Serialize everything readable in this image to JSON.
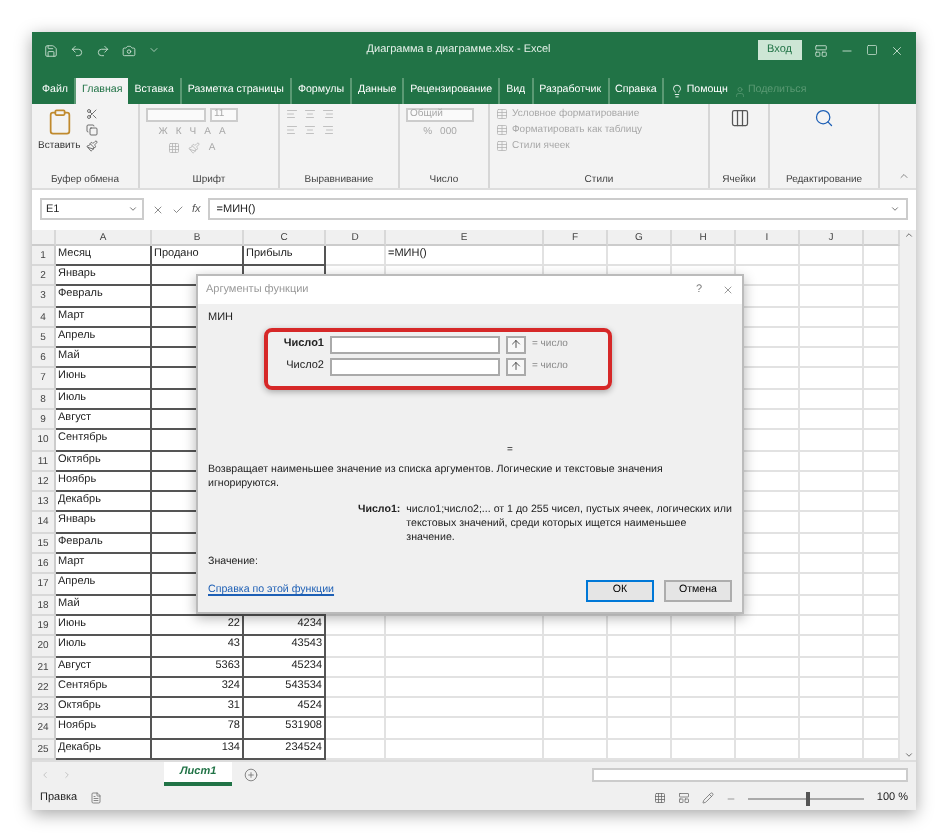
{
  "window": {
    "title": "Диаграмма в диаграмме.xlsx - Excel",
    "sign_in": "Вход"
  },
  "tabs": [
    {
      "label": "Файл",
      "selected": false
    },
    {
      "label": "Главная",
      "selected": true
    },
    {
      "label": "Вставка",
      "selected": false
    },
    {
      "label": "Разметка страницы",
      "selected": false
    },
    {
      "label": "Формулы",
      "selected": false
    },
    {
      "label": "Данные",
      "selected": false
    },
    {
      "label": "Рецензирование",
      "selected": false
    },
    {
      "label": "Вид",
      "selected": false
    },
    {
      "label": "Разработчик",
      "selected": false
    },
    {
      "label": "Справка",
      "selected": false
    }
  ],
  "help_search": "Помощн",
  "share": "Поделиться",
  "ribbon": {
    "groups": [
      {
        "kind": "clipboard",
        "label": "Буфер обмена",
        "disabled": false,
        "items": [
          "Вставить"
        ]
      },
      {
        "kind": "font",
        "label": "Шрифт",
        "disabled": true,
        "items": [
          "11",
          "Ж",
          "К",
          "Ч",
          "A",
          "A",
          "A"
        ]
      },
      {
        "kind": "align",
        "label": "Выравнивание",
        "disabled": true
      },
      {
        "kind": "number",
        "label": "Число",
        "disabled": true,
        "items": [
          "Общий",
          "%",
          "000"
        ]
      },
      {
        "kind": "styles",
        "label": "Стили",
        "disabled": true,
        "items": [
          "Условное форматирование",
          "Форматировать как таблицу",
          "Стили ячеек"
        ]
      },
      {
        "kind": "cells",
        "label": "Ячейки",
        "disabled": false
      },
      {
        "kind": "editing",
        "label": "Редактирование",
        "disabled": false
      }
    ]
  },
  "formula_bar": {
    "cell": "E1",
    "fx": "fx",
    "formula": "=МИН()"
  },
  "sheet": {
    "columns": [
      "A",
      "B",
      "C",
      "D",
      "E",
      "F",
      "G",
      "H",
      "I",
      "J"
    ],
    "rows": [
      {
        "n": "1",
        "a": "Месяц",
        "b": "Продано",
        "c": "Прибыль",
        "e": "=МИН()"
      },
      {
        "n": "2",
        "a": "Январь"
      },
      {
        "n": "3",
        "a": "Февраль"
      },
      {
        "n": "4",
        "a": "Март"
      },
      {
        "n": "5",
        "a": "Апрель"
      },
      {
        "n": "6",
        "a": "Май"
      },
      {
        "n": "7",
        "a": "Июнь"
      },
      {
        "n": "8",
        "a": "Июль"
      },
      {
        "n": "9",
        "a": "Август"
      },
      {
        "n": "10",
        "a": "Сентябрь"
      },
      {
        "n": "11",
        "a": "Октябрь"
      },
      {
        "n": "12",
        "a": "Ноябрь"
      },
      {
        "n": "13",
        "a": "Декабрь"
      },
      {
        "n": "14",
        "a": "Январь"
      },
      {
        "n": "15",
        "a": "Февраль"
      },
      {
        "n": "16",
        "a": "Март"
      },
      {
        "n": "17",
        "a": "Апрель"
      },
      {
        "n": "18",
        "a": "Май"
      },
      {
        "n": "19",
        "a": "Июнь",
        "b": "22",
        "c": "4234"
      },
      {
        "n": "20",
        "a": "Июль",
        "b": "43",
        "c": "43543"
      },
      {
        "n": "21",
        "a": "Август",
        "b": "5363",
        "c": "45234"
      },
      {
        "n": "22",
        "a": "Сентябрь",
        "b": "324",
        "c": "543534"
      },
      {
        "n": "23",
        "a": "Октябрь",
        "b": "31",
        "c": "4524"
      },
      {
        "n": "24",
        "a": "Ноябрь",
        "b": "78",
        "c": "531908"
      },
      {
        "n": "25",
        "a": "Декабрь",
        "b": "134",
        "c": "234524"
      }
    ]
  },
  "dialog": {
    "title": "Аргументы функции",
    "help": "?",
    "function": "МИН",
    "args": [
      {
        "label": "Число1",
        "active": true,
        "hint": "= число"
      },
      {
        "label": "Число2",
        "active": false,
        "hint": "= число"
      }
    ],
    "result_sign": "=",
    "description": "Возвращает наименьшее значение из списка аргументов. Логические и текстовые значения игнорируются.",
    "arg_name": "Число1:",
    "arg_description": "число1;число2;... от 1 до 255 чисел, пустых ячеек, логических или текстовых значений, среди которых ищется наименьшее значение.",
    "value_label": "Значение:",
    "help_link": "Справка по этой функции",
    "buttons": [
      "ОК",
      "Отмена"
    ]
  },
  "sheet_tabs": [
    {
      "label": "Лист1",
      "selected": true
    }
  ],
  "status_bar": {
    "mode": "Правка",
    "zoom": "100 %",
    "level": 0.5
  }
}
